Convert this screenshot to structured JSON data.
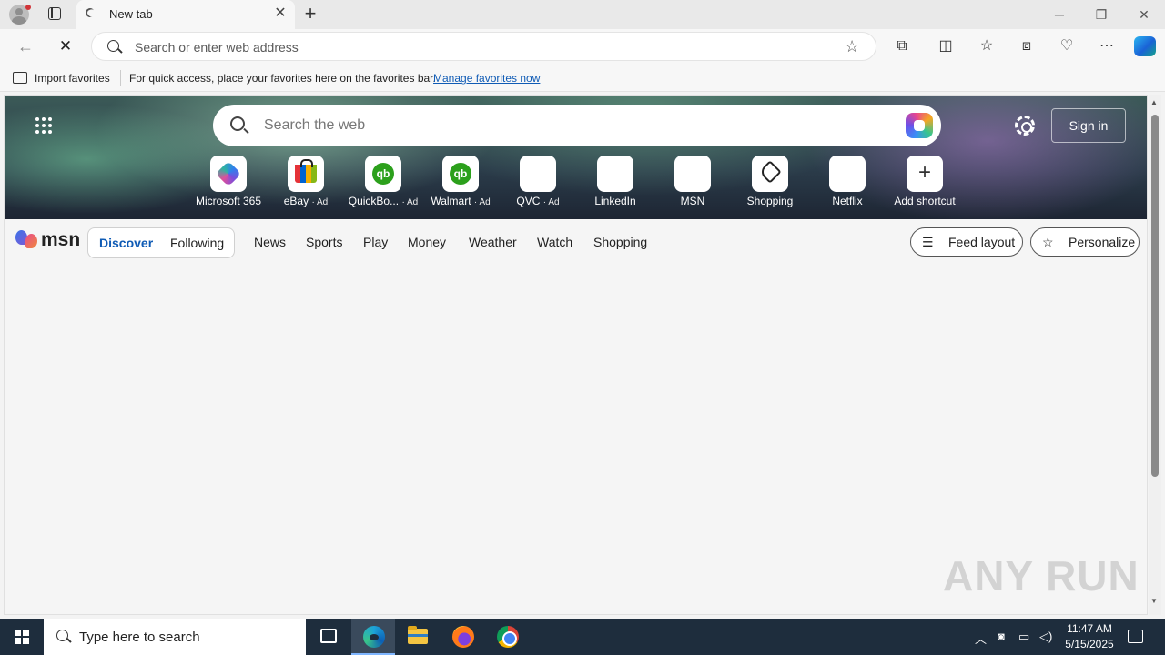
{
  "browser": {
    "tab_title": "New tab",
    "address_placeholder": "Search or enter web address"
  },
  "favorites_bar": {
    "import_label": "Import favorites",
    "message": "For quick access, place your favorites here on the favorites bar.",
    "manage_link": "Manage favorites now"
  },
  "newtab": {
    "search_placeholder": "Search the web",
    "sign_in_label": "Sign in",
    "shortcuts": [
      {
        "label": "Microsoft 365",
        "ad": "",
        "icon": "microsoft365-icon"
      },
      {
        "label": "eBay",
        "ad": "· Ad",
        "icon": "ebay-icon"
      },
      {
        "label": "QuickBo...",
        "ad": "· Ad",
        "icon": "quickbooks-icon"
      },
      {
        "label": "Walmart",
        "ad": "· Ad",
        "icon": "quickbooks-icon"
      },
      {
        "label": "QVC",
        "ad": "· Ad",
        "icon": "qvc-icon"
      },
      {
        "label": "LinkedIn",
        "ad": "",
        "icon": "linkedin-icon"
      },
      {
        "label": "MSN",
        "ad": "",
        "icon": "msn-icon"
      },
      {
        "label": "Shopping",
        "ad": "",
        "icon": "tag-icon"
      },
      {
        "label": "Netflix",
        "ad": "",
        "icon": "netflix-icon"
      },
      {
        "label": "Add shortcut",
        "ad": "",
        "icon": "plus-icon"
      }
    ]
  },
  "msn": {
    "logo_text": "msn",
    "discover_label": "Discover",
    "following_label": "Following",
    "nav_items": [
      "News",
      "Sports",
      "Play",
      "Money",
      "Weather",
      "Watch",
      "Shopping"
    ],
    "feed_layout_label": "Feed layout",
    "personalize_label": "Personalize"
  },
  "watermark": "ANY RUN",
  "taskbar": {
    "search_placeholder": "Type here to search",
    "time": "11:47 AM",
    "date": "5/15/2025"
  }
}
